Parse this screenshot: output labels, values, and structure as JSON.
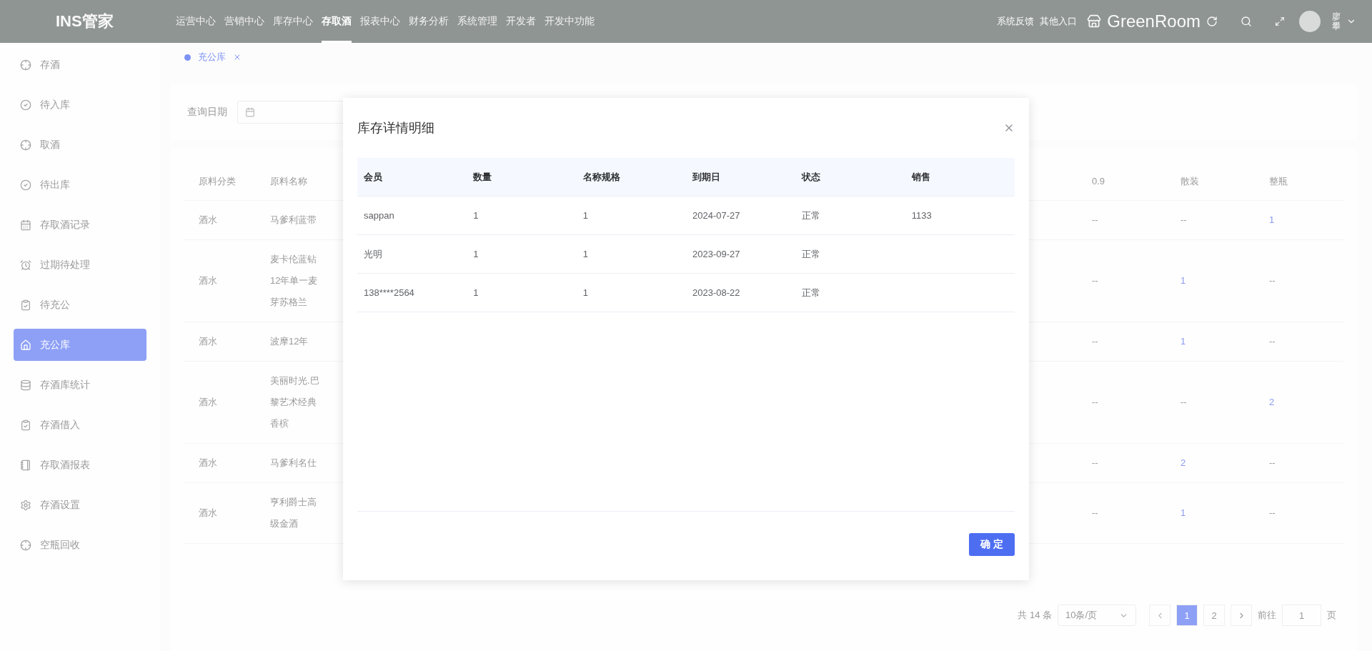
{
  "header": {
    "logo": "INS管家",
    "nav": [
      {
        "label": "运营中心",
        "selected": false
      },
      {
        "label": "营销中心",
        "selected": false
      },
      {
        "label": "库存中心",
        "selected": false
      },
      {
        "label": "存取酒",
        "selected": true
      },
      {
        "label": "报表中心",
        "selected": false
      },
      {
        "label": "财务分析",
        "selected": false
      },
      {
        "label": "系统管理",
        "selected": false
      },
      {
        "label": "开发者",
        "selected": false
      },
      {
        "label": "开发中功能",
        "selected": false
      }
    ],
    "links": [
      "系统反馈",
      "其他入口"
    ],
    "store_name": "GreenRoom",
    "user_name": "廖攀"
  },
  "sidebar": {
    "items": [
      {
        "label": "存酒",
        "selected": false
      },
      {
        "label": "待入库",
        "selected": false
      },
      {
        "label": "取酒",
        "selected": false
      },
      {
        "label": "待出库",
        "selected": false
      },
      {
        "label": "存取酒记录",
        "selected": false
      },
      {
        "label": "过期待处理",
        "selected": false
      },
      {
        "label": "待充公",
        "selected": false
      },
      {
        "label": "充公库",
        "selected": true
      },
      {
        "label": "存酒库统计",
        "selected": false
      },
      {
        "label": "存酒借入",
        "selected": false
      },
      {
        "label": "存取酒报表",
        "selected": false
      },
      {
        "label": "存酒设置",
        "selected": false
      },
      {
        "label": "空瓶回收",
        "selected": false
      }
    ]
  },
  "tabs": [
    {
      "label": "充公库",
      "selected": true
    }
  ],
  "filter": {
    "label": "查询日期"
  },
  "table": {
    "columns": [
      "原料分类",
      "原料名称",
      "0.9",
      "散装",
      "整瓶"
    ],
    "rows": [
      [
        "酒水",
        "马爹利蓝带",
        "--",
        "--",
        "1"
      ],
      [
        "酒水",
        "麦卡伦蓝钻12年单一麦芽苏格兰",
        "--",
        "1",
        "--"
      ],
      [
        "酒水",
        "波摩12年",
        "--",
        "1",
        "--"
      ],
      [
        "酒水",
        "美丽时光.巴黎艺术经典香槟",
        "--",
        "--",
        "2"
      ],
      [
        "酒水",
        "马爹利名仕",
        "--",
        "2",
        "--"
      ],
      [
        "酒水",
        "亨利爵士高级金酒",
        "--",
        "1",
        "--"
      ]
    ]
  },
  "pagination": {
    "total": "共 14 条",
    "page_size": "10条/页",
    "pages": [
      {
        "label": "1",
        "selected": true
      },
      {
        "label": "2",
        "selected": false
      }
    ],
    "goto_label": "前往",
    "goto_value": "1",
    "goto_suffix": "页"
  },
  "modal": {
    "title": "库存详情明细",
    "columns": [
      "会员",
      "数量",
      "名称规格",
      "到期日",
      "状态",
      "销售"
    ],
    "rows": [
      [
        "sappan",
        "1",
        "1",
        "2024-07-27",
        "正常",
        "1133"
      ],
      [
        "光明",
        "1",
        "1",
        "2023-09-27",
        "正常",
        ""
      ],
      [
        "138****2564",
        "1",
        "1",
        "2023-08-22",
        "正常",
        ""
      ]
    ],
    "confirm": "确 定"
  }
}
